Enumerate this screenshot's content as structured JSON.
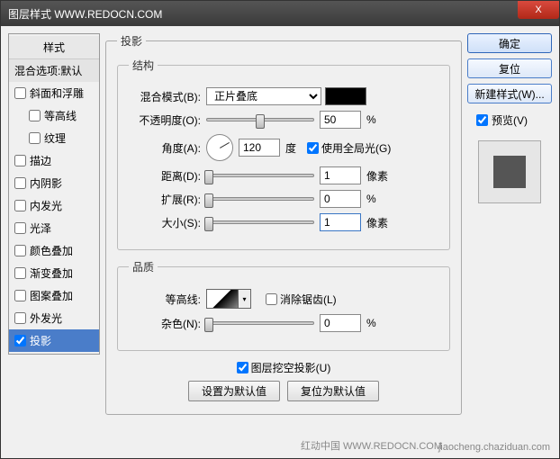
{
  "titlebar": {
    "title": "图层样式   WWW.REDOCN.COM",
    "close": "X"
  },
  "left": {
    "header": "样式",
    "blend_opts": "混合选项:默认",
    "items": [
      {
        "label": "斜面和浮雕",
        "checked": false,
        "indent": false
      },
      {
        "label": "等高线",
        "checked": false,
        "indent": true
      },
      {
        "label": "纹理",
        "checked": false,
        "indent": true
      },
      {
        "label": "描边",
        "checked": false,
        "indent": false
      },
      {
        "label": "内阴影",
        "checked": false,
        "indent": false
      },
      {
        "label": "内发光",
        "checked": false,
        "indent": false
      },
      {
        "label": "光泽",
        "checked": false,
        "indent": false
      },
      {
        "label": "颜色叠加",
        "checked": false,
        "indent": false
      },
      {
        "label": "渐变叠加",
        "checked": false,
        "indent": false
      },
      {
        "label": "图案叠加",
        "checked": false,
        "indent": false
      },
      {
        "label": "外发光",
        "checked": false,
        "indent": false
      },
      {
        "label": "投影",
        "checked": true,
        "indent": false,
        "selected": true
      }
    ]
  },
  "center": {
    "panel_title": "投影",
    "structure": {
      "legend": "结构",
      "blend_mode_label": "混合模式(B):",
      "blend_mode_value": "正片叠底",
      "opacity_label": "不透明度(O):",
      "opacity_value": "50",
      "opacity_unit": "%",
      "angle_label": "角度(A):",
      "angle_value": "120",
      "angle_unit": "度",
      "global_light": "使用全局光(G)",
      "global_light_checked": true,
      "distance_label": "距离(D):",
      "distance_value": "1",
      "distance_unit": "像素",
      "spread_label": "扩展(R):",
      "spread_value": "0",
      "spread_unit": "%",
      "size_label": "大小(S):",
      "size_value": "1",
      "size_unit": "像素"
    },
    "quality": {
      "legend": "品质",
      "contour_label": "等高线:",
      "antialias": "消除锯齿(L)",
      "noise_label": "杂色(N):",
      "noise_value": "0",
      "noise_unit": "%"
    },
    "knockout": "图层挖空投影(U)",
    "knockout_checked": true,
    "btn_default": "设置为默认值",
    "btn_reset": "复位为默认值"
  },
  "right": {
    "ok": "确定",
    "cancel": "复位",
    "new_style": "新建样式(W)...",
    "preview": "预览(V)",
    "preview_checked": true
  },
  "footer": {
    "w1": "红动中国  WWW.REDOCN.COM",
    "w2": "jiaocheng.chaziduan.com"
  }
}
